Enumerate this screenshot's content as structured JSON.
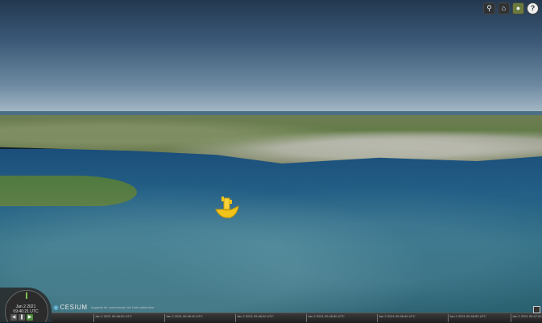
{
  "toolbar": {
    "search_icon": "search-icon",
    "home_icon": "home-icon",
    "base_layer_icon": "globe-icon",
    "help_label": "?"
  },
  "animation": {
    "date": "Jan 2 2021",
    "time": "09:46:21 UTC",
    "speed": "1x",
    "rewind_icon": "rewind-icon",
    "pause_icon": "pause-icon",
    "play_icon": "play-icon"
  },
  "credits": {
    "logo": "CESIUM",
    "text": "Upgrade for commercial use  Data attribution"
  },
  "timeline": {
    "ticks": [
      "Jan 2 2021 09:46:00 UTC",
      "Jan 2 2021 09:46:10 UTC",
      "Jan 2 2021 09:46:20 UTC",
      "Jan 2 2021 09:46:30 UTC",
      "Jan 2 2021 09:46:40 UTC",
      "Jan 2 2021 09:46:50 UTC",
      "Jan 2 2021 09:47:00 UTC"
    ]
  },
  "colors": {
    "sky": "#3a5876",
    "sea": "#235f86",
    "land": "#5e7a43",
    "marker": "#f2c318",
    "play_active": "#4c8a3a"
  }
}
